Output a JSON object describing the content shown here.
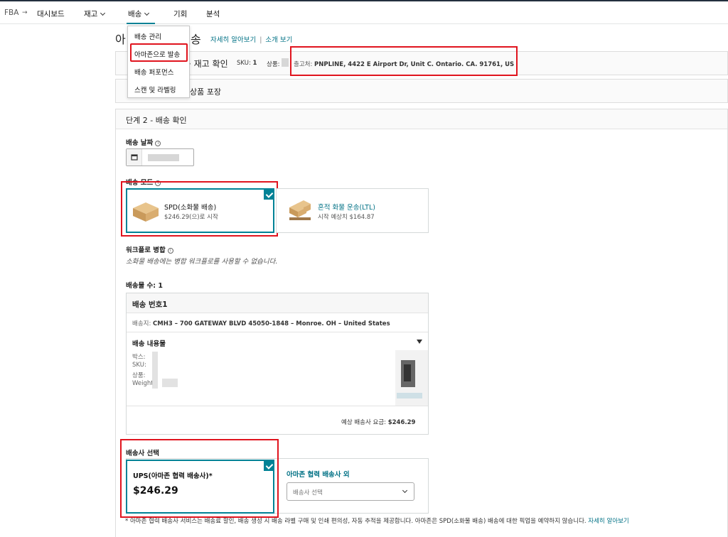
{
  "nav": {
    "fba": "FBA",
    "dashboard": "대시보드",
    "inventory": "재고",
    "shipping": "배송",
    "opportunities": "기회",
    "analytics": "분석"
  },
  "dropdown": {
    "items": [
      "배송 관리",
      "아마존으로 발송",
      "배송 퍼포먼스",
      "스캔 및 라벨링"
    ]
  },
  "page": {
    "title_prefix": "아",
    "title_suffix": "송",
    "learn_more": "자세히 알아보기",
    "intro_video": "소개 보기"
  },
  "step1": {
    "label": "재고 확인",
    "sku_label": "SKU:",
    "sku_value": "1",
    "product_label": "상품:",
    "ship_from_label": "출고처:",
    "ship_from_value": "PNPLINE, 4422 E Airport Dr, Unit C. Ontario. CA. 91761, US"
  },
  "step_pack": {
    "label": "상품 포장"
  },
  "step2": {
    "header": "단계 2 - 배송 확인",
    "ship_date_label": "배송 날짜",
    "ship_mode_label": "배송 모드",
    "spd": {
      "title": "SPD(소화물 배송)",
      "price": "$246.29(으)로 시작"
    },
    "ltl": {
      "title": "혼적 화물 운송(LTL)",
      "price": "시작 예상치 $164.87"
    },
    "workflow_label": "워크플로 병합",
    "workflow_note": "소화물 배송에는 병합 워크플로를 사용할 수 없습니다.",
    "shipment_count_label": "배송물 수: 1",
    "shipment": {
      "header": "배송 번호1",
      "dest_label": "배송지:",
      "dest_value": "CMH3 – 700 GATEWAY BLVD 45050-1848 – Monroe. OH – United States",
      "contents_label": "배송 내용물",
      "boxes_label": "박스:",
      "sku_label": "SKU:",
      "product_label": "상품:",
      "weight_label": "Weight:",
      "est_fee_label": "예상 배송사 요금:",
      "est_fee_value": "$246.29"
    },
    "carrier": {
      "label": "배송사 선택",
      "ups_title": "UPS(아마존 협력 배송사)*",
      "ups_price": "$246.29",
      "other_title": "아마존 협력 배송사 외",
      "select_placeholder": "배송사 선택"
    },
    "footnote": "* 아마존 협력 배송사 서비스는 배송료 할인, 배송 생성 시 배송 라벨 구매 및 인쇄 편의성, 자동 추적을 제공합니다. 아마존은 SPD(소화물 배송) 배송에 대한 픽업을 예약하지 않습니다.",
    "footnote_link": "자세히 알아보기"
  },
  "colors": {
    "accent": "#008296",
    "link": "#007185",
    "highlight": "#e0141e"
  }
}
